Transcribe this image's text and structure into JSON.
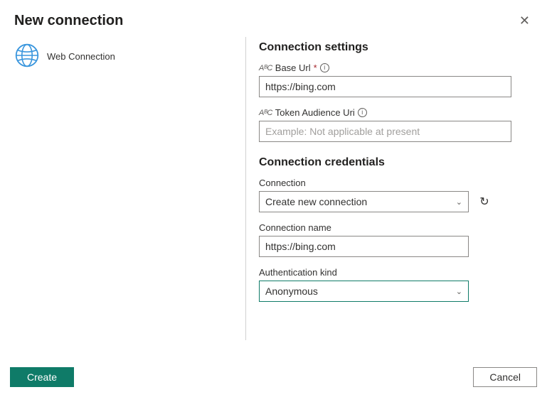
{
  "header": {
    "title": "New connection"
  },
  "left": {
    "item_label": "Web Connection"
  },
  "settings": {
    "section_title": "Connection settings",
    "abc_prefix": "AᴮC",
    "base_url": {
      "label": "Base Url",
      "required_marker": "*",
      "value": "https://bing.com"
    },
    "token_audience": {
      "label": "Token Audience Uri",
      "placeholder": "Example: Not applicable at present"
    }
  },
  "credentials": {
    "section_title": "Connection credentials",
    "connection": {
      "label": "Connection",
      "selected": "Create new connection"
    },
    "connection_name": {
      "label": "Connection name",
      "value": "https://bing.com"
    },
    "auth_kind": {
      "label": "Authentication kind",
      "selected": "Anonymous"
    }
  },
  "buttons": {
    "create": "Create",
    "cancel": "Cancel"
  }
}
